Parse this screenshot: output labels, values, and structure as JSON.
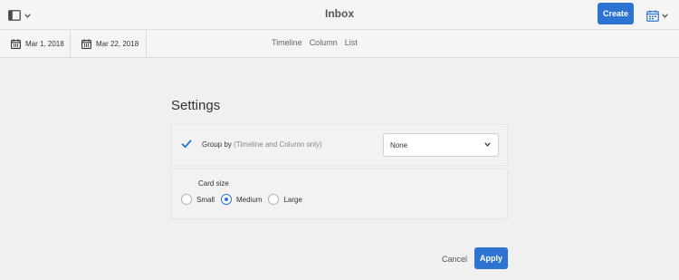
{
  "header": {
    "title": "Inbox",
    "rail_icon": "sidebar-panel-icon",
    "create_label": "Create",
    "calendar_menu_icon": "calendar-icon"
  },
  "filters": {
    "start_date": "Mar 1, 2018",
    "end_date": "Mar 22, 2018",
    "views": [
      "Timeline",
      "Column",
      "List"
    ]
  },
  "settings": {
    "title": "Settings",
    "group_by": {
      "checked": true,
      "label": "Group by",
      "hint": "(Timeline and Column only)",
      "selected": "None"
    },
    "card_size": {
      "label": "Card size",
      "options": [
        "Small",
        "Medium",
        "Large"
      ],
      "selected": "Medium"
    }
  },
  "actions": {
    "cancel": "Cancel",
    "apply": "Apply"
  },
  "colors": {
    "accent": "#2d74d2",
    "background": "#f0f0f0"
  }
}
